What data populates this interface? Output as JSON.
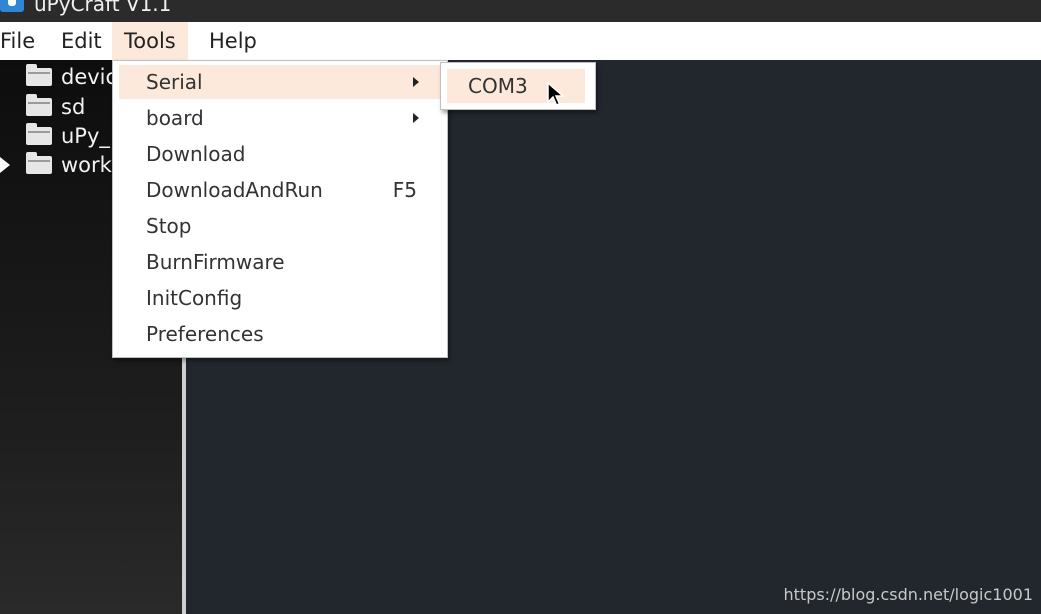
{
  "window": {
    "title": "uPyCraft V1.1",
    "app_icon": "python-logo-icon"
  },
  "menubar": {
    "items": [
      {
        "label": "File"
      },
      {
        "label": "Edit"
      },
      {
        "label": "Tools",
        "active": true
      },
      {
        "label": "Help"
      }
    ]
  },
  "tree": {
    "items": [
      {
        "label": "devic",
        "icon": "folder-icon"
      },
      {
        "label": "sd",
        "icon": "folder-icon"
      },
      {
        "label": "uPy_",
        "icon": "folder-icon"
      },
      {
        "label": "workS",
        "icon": "folder-icon",
        "expandable": true
      }
    ]
  },
  "tools_menu": {
    "items": [
      {
        "label": "Serial",
        "submenu": true,
        "active": true
      },
      {
        "label": "board",
        "submenu": true
      },
      {
        "label": "Download"
      },
      {
        "label": "DownloadAndRun",
        "shortcut": "F5"
      },
      {
        "label": "Stop"
      },
      {
        "label": "BurnFirmware"
      },
      {
        "label": "InitConfig"
      },
      {
        "label": "Preferences"
      }
    ]
  },
  "serial_submenu": {
    "items": [
      {
        "label": "COM3",
        "active": true
      }
    ]
  },
  "watermark": "https://blog.csdn.net/logic1001",
  "colors": {
    "menu_highlight": "#fde9dc",
    "editor_bg": "#22272e",
    "tree_bg": "#1a1a1a"
  }
}
